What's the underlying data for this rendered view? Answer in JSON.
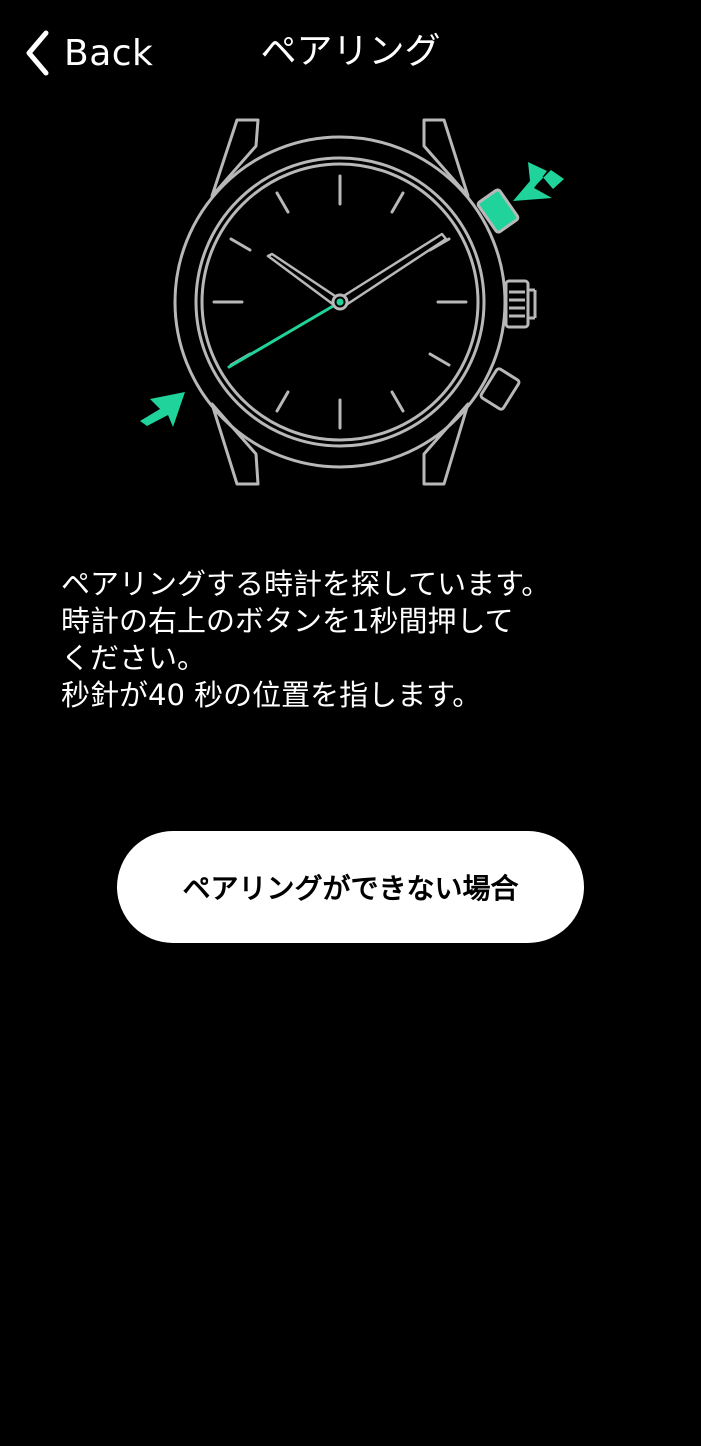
{
  "header": {
    "back_label": "Back",
    "title": "ペアリング"
  },
  "illustration": {
    "accent_color": "#1fd39a",
    "line_color": "#b8b8b8",
    "icons": [
      "watch-icon",
      "arrow-icon"
    ]
  },
  "instructions": {
    "line1": "ペアリングする時計を探しています。",
    "line2": "時計の右上のボタンを1秒間押して",
    "line3": "ください。",
    "line4": "秒針が40 秒の位置を指します。"
  },
  "help_button": {
    "label": "ペアリングができない場合"
  }
}
